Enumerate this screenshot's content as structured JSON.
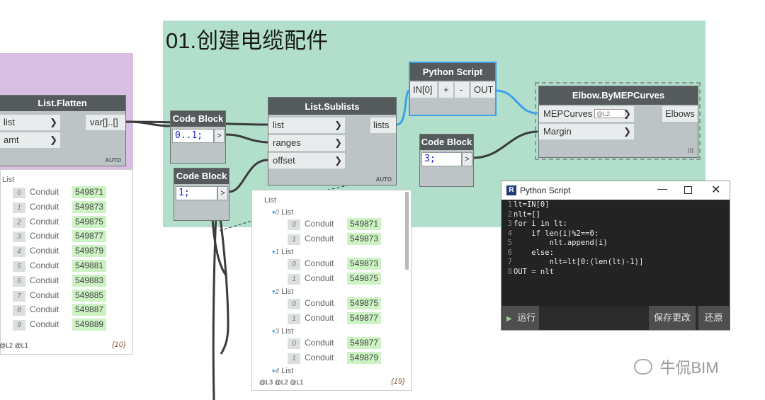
{
  "group": {
    "title": "01.创建电缆配件"
  },
  "list_flatten": {
    "title": "List.Flatten",
    "inputs": [
      "list",
      "amt"
    ],
    "output": "var[]..[]",
    "lacing": "AUTO"
  },
  "code_block_1": {
    "title": "Code Block",
    "code": "0..1;",
    "out": ">"
  },
  "code_block_2": {
    "title": "Code Block",
    "code": "1;",
    "out": ">"
  },
  "code_block_3": {
    "title": "Code Block",
    "code": "3;",
    "out": ">"
  },
  "list_sublists": {
    "title": "List.Sublists",
    "inputs": [
      "list",
      "ranges",
      "offset"
    ],
    "output": "lists",
    "lacing": "AUTO"
  },
  "python_node": {
    "title": "Python Script",
    "input": "IN[0]",
    "plus": "+",
    "minus": "-",
    "output": "OUT"
  },
  "elbow_node": {
    "title": "Elbow.ByMEPCurves",
    "inputs": [
      "MEPCurves",
      "Margin"
    ],
    "level": "@L2",
    "output": "Elbows",
    "lacing": "III"
  },
  "preview_left": {
    "root": "List",
    "type": "Conduit",
    "items": [
      {
        "idx": "0",
        "val": "549871"
      },
      {
        "idx": "1",
        "val": "549873"
      },
      {
        "idx": "2",
        "val": "549875"
      },
      {
        "idx": "3",
        "val": "549877"
      },
      {
        "idx": "4",
        "val": "549879"
      },
      {
        "idx": "5",
        "val": "549881"
      },
      {
        "idx": "6",
        "val": "549883"
      },
      {
        "idx": "7",
        "val": "549885"
      },
      {
        "idx": "8",
        "val": "549887"
      },
      {
        "idx": "9",
        "val": "549889"
      }
    ],
    "levels": "@L2 @L1",
    "count": "{10}"
  },
  "preview_mid": {
    "root": "List",
    "sub_label": "List",
    "type": "Conduit",
    "groups": [
      {
        "idx": "0",
        "items": [
          {
            "idx": "0",
            "val": "549871"
          },
          {
            "idx": "1",
            "val": "549873"
          }
        ]
      },
      {
        "idx": "1",
        "items": [
          {
            "idx": "0",
            "val": "549873"
          },
          {
            "idx": "1",
            "val": "549875"
          }
        ]
      },
      {
        "idx": "2",
        "items": [
          {
            "idx": "0",
            "val": "549875"
          },
          {
            "idx": "1",
            "val": "549877"
          }
        ]
      },
      {
        "idx": "3",
        "items": [
          {
            "idx": "0",
            "val": "549877"
          },
          {
            "idx": "1",
            "val": "549879"
          }
        ]
      },
      {
        "idx": "4",
        "items": []
      }
    ],
    "levels": "@L3 @L2 @L1",
    "count": "{19}"
  },
  "python_window": {
    "title": "Python Script",
    "app_icon": "R",
    "code_lines": [
      "lt=IN[0]",
      "nlt=[]",
      "for i in lt:",
      "    if len(i)%2==0:",
      "        nlt.append(i)",
      "    else:",
      "        nlt=lt[0:(len(lt)-1)]",
      "OUT = nlt"
    ],
    "run_label": "运行",
    "save_label": "保存更改",
    "revert_label": "还原"
  },
  "watermark": {
    "text": "牛侃BIM"
  },
  "colors": {
    "purple_group": "#d9bfe1",
    "green_group": "#b1dfcb",
    "wire_blue": "#3fa0e8",
    "value_green": "#cdf3c4"
  }
}
